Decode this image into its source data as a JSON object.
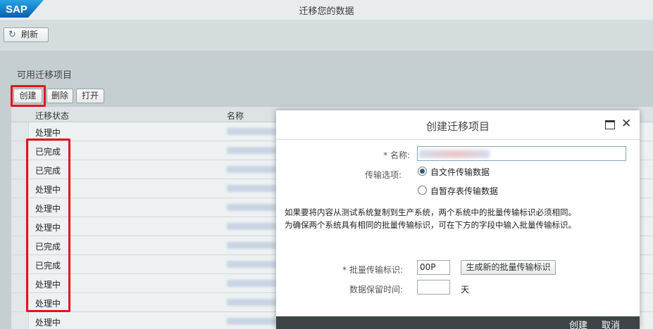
{
  "shell": {
    "logo_text": "SAP",
    "title": "迁移您的数据"
  },
  "toolbar": {
    "refresh_label": "刷新",
    "refresh_icon": "refresh-icon"
  },
  "section": {
    "title": "可用迁移项目",
    "create_label": "创建",
    "delete_label": "删除",
    "open_label": "打开"
  },
  "table": {
    "columns": [
      "迁移状态",
      "名称"
    ],
    "rows": [
      {
        "status": "处理中"
      },
      {
        "status": "已完成"
      },
      {
        "status": "已完成"
      },
      {
        "status": "处理中"
      },
      {
        "status": "处理中"
      },
      {
        "status": "处理中"
      },
      {
        "status": "已完成"
      },
      {
        "status": "已完成"
      },
      {
        "status": "处理中"
      },
      {
        "status": "处理中"
      },
      {
        "status": "处理中"
      }
    ]
  },
  "dialog": {
    "title": "创建迁移项目",
    "name_label": "* 名称:",
    "transfer_label": "传输选项:",
    "option_file": "自文件传输数据",
    "option_staging": "自暂存表传输数据",
    "description_line1": "如果要将内容从测试系统复制到生产系统，两个系统中的批量传输标识必须相同。",
    "description_line2": "为确保两个系统具有相同的批量传输标识，可在下方的字段中输入批量传输标识。",
    "mass_transfer_label": "* 批量传输标识:",
    "mass_transfer_value": "00P",
    "generate_label": "生成新的批量传输标识",
    "retention_label": "数据保留时间:",
    "retention_unit": "天",
    "footer_create": "创建",
    "footer_cancel": "取消"
  },
  "colors": {
    "highlight": "#e3141d",
    "footer": "#3f4447",
    "logo_blue": "#1a6fc3"
  }
}
